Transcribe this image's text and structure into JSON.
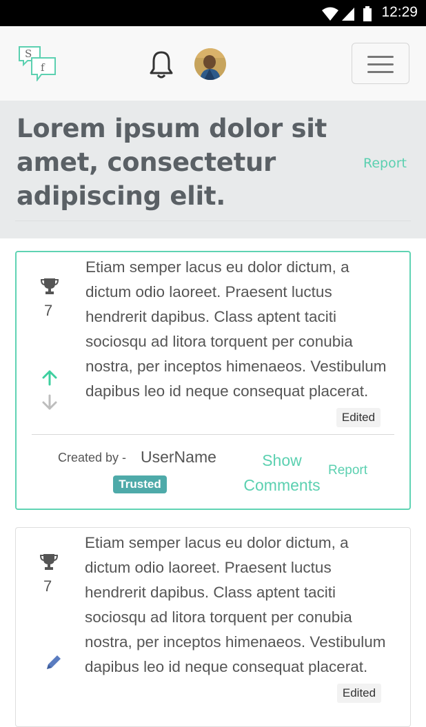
{
  "status_bar": {
    "time": "12:29"
  },
  "header": {
    "title": "Lorem ipsum dolor sit amet, consectetur adipiscing elit.",
    "report_label": "Report"
  },
  "cards": [
    {
      "score": "7",
      "body": "Etiam semper lacus eu dolor dictum, a dictum odio laoreet. Praesent luctus hendrerit dapibus. Class aptent taciti sociosqu ad litora torquent per conubia nostra, per inceptos himenaeos. Vestibulum dapibus leo id neque consequat placerat.",
      "edited_label": "Edited",
      "created_by_label": "Created by -",
      "username": "UserName",
      "badge": "Trusted",
      "show_comments_label": "Show Comments",
      "report_label": "Report"
    },
    {
      "score": "7",
      "body": "Etiam semper lacus eu dolor dictum, a dictum odio laoreet. Praesent luctus hendrerit dapibus. Class aptent taciti sociosqu ad litora torquent per conubia nostra, per inceptos himenaeos. Vestibulum dapibus leo id neque consequat placerat.",
      "edited_label": "Edited"
    }
  ],
  "colors": {
    "accent": "#5bd0b0",
    "header_bg": "#e8eaeb",
    "badge": "#4eaaa9",
    "upvote": "#3dcf9f",
    "downvote": "#bdbdbd",
    "pencil": "#5a7cc0"
  },
  "icons": [
    "wifi-icon",
    "signal-icon",
    "battery-icon",
    "logo-icon",
    "bell-icon",
    "avatar",
    "hamburger-icon",
    "trophy-icon",
    "upvote-arrow-icon",
    "downvote-arrow-icon",
    "pencil-icon"
  ]
}
